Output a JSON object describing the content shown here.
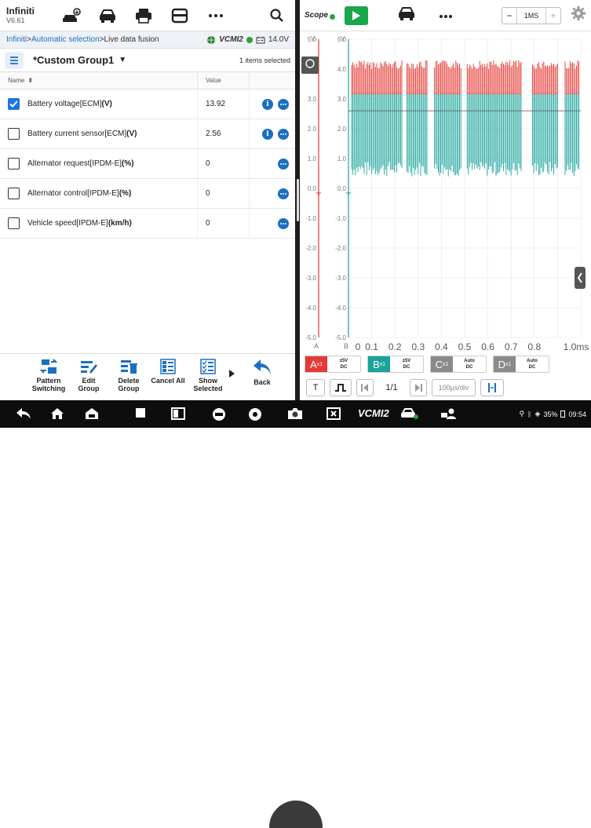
{
  "app": {
    "name": "Infiniti",
    "version": "V6.61"
  },
  "breadcrumb": {
    "part1": "Infiniti",
    "sep1": " > ",
    "part2": "Automatic selection",
    "sep2": " > ",
    "part3": "Live data fusion",
    "vcmi": "VCMI2",
    "voltage": "14.0V"
  },
  "group": {
    "name": "*Custom Group1",
    "selected": "1 items selected"
  },
  "table": {
    "col_name": "Name",
    "col_value": "Value",
    "rows": [
      {
        "name": "Battery voltage[ECM]",
        "unit": "(V)",
        "value": "13.92",
        "checked": true,
        "info": true
      },
      {
        "name": "Battery current sensor[ECM]",
        "unit": "(V)",
        "value": "2.56",
        "checked": false,
        "info": true
      },
      {
        "name": "Alternator request[IPDM-E]",
        "unit": "(%)",
        "value": "0",
        "checked": false,
        "info": false
      },
      {
        "name": "Alternator control[IPDM-E]",
        "unit": "(%)",
        "value": "0",
        "checked": false,
        "info": false
      },
      {
        "name": "Vehicle speed[IPDM-E]",
        "unit": "(km/h)",
        "value": "0",
        "checked": false,
        "info": false
      }
    ]
  },
  "bottom": {
    "pattern": "Pattern Switching",
    "edit": "Edit Group",
    "delete": "Delete Group",
    "cancel": "Cancel All",
    "show": "Show Selected",
    "back": "Back"
  },
  "scope": {
    "label": "Scope",
    "timebase": "1MS",
    "y_ticks_a": [
      "5.0",
      "4.0",
      "3.0",
      "2.0",
      "1.0",
      "0.0",
      "-1.0",
      "-2.0",
      "-3.0",
      "-4.0",
      "-5.0"
    ],
    "y_ticks_b": [
      "5.0",
      "4.0",
      "3.0",
      "2.0",
      "1.0",
      "0.0",
      "-1.0",
      "-2.0",
      "-3.0",
      "-4.0",
      "-5.0"
    ],
    "x_ticks": [
      "0",
      "0.1",
      "0.2",
      "0.3",
      "0.4",
      "0.5",
      "0.6",
      "0.7",
      "0.8",
      "1.0ms"
    ],
    "axis_a": "A",
    "axis_b": "B",
    "unit_v": "V"
  },
  "channels": [
    {
      "letter": "A",
      "sub": "x1",
      "l1": "±5V",
      "l2": "DC",
      "color": "#e53935"
    },
    {
      "letter": "B",
      "sub": "x1",
      "l1": "±5V",
      "l2": "DC",
      "color": "#1aa39a"
    },
    {
      "letter": "C",
      "sub": "x1",
      "l1": "Auto",
      "l2": "DC",
      "color": "#8a8a8a"
    },
    {
      "letter": "D",
      "sub": "x1",
      "l1": "Auto",
      "l2": "DC",
      "color": "#8a8a8a"
    }
  ],
  "trigger": {
    "t": "T",
    "page": "1/1",
    "rate": "100µs/div"
  },
  "status": {
    "battery": "35%",
    "time": "09:54"
  }
}
